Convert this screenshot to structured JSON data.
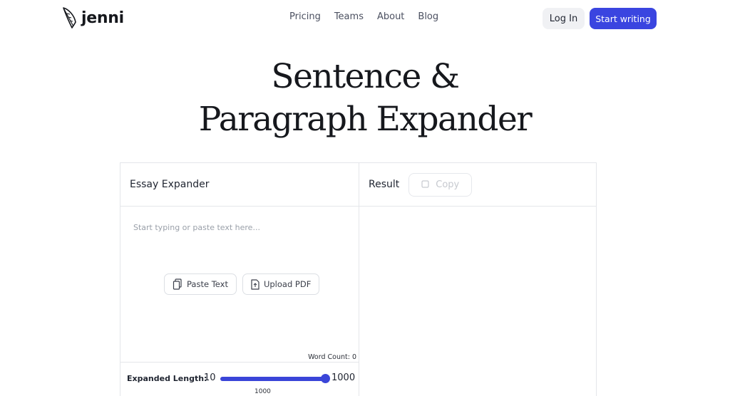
{
  "header": {
    "logo_text": "jenni",
    "logo_icon": "feather-quill-icon",
    "nav": [
      "Pricing",
      "Teams",
      "About",
      "Blog"
    ],
    "login_label": "Log In",
    "start_label": "Start writing",
    "accent_color": "#3a45e0"
  },
  "hero": {
    "title_line1": "Sentence &",
    "title_line2": "Paragraph Expander"
  },
  "input_panel": {
    "title": "Essay Expander",
    "placeholder": "Start typing or paste text here...",
    "paste_label": "Paste Text",
    "paste_icon": "clipboard-icon",
    "upload_label": "Upload PDF",
    "upload_icon": "file-upload-icon",
    "word_count": "Word Count: 0"
  },
  "result_panel": {
    "title": "Result",
    "copy_label": "Copy",
    "copy_icon": "copy-icon"
  },
  "length": {
    "label": "Expanded Length:",
    "min": "10",
    "max": "1000",
    "value": "1000",
    "fill_fraction": 1.0
  }
}
